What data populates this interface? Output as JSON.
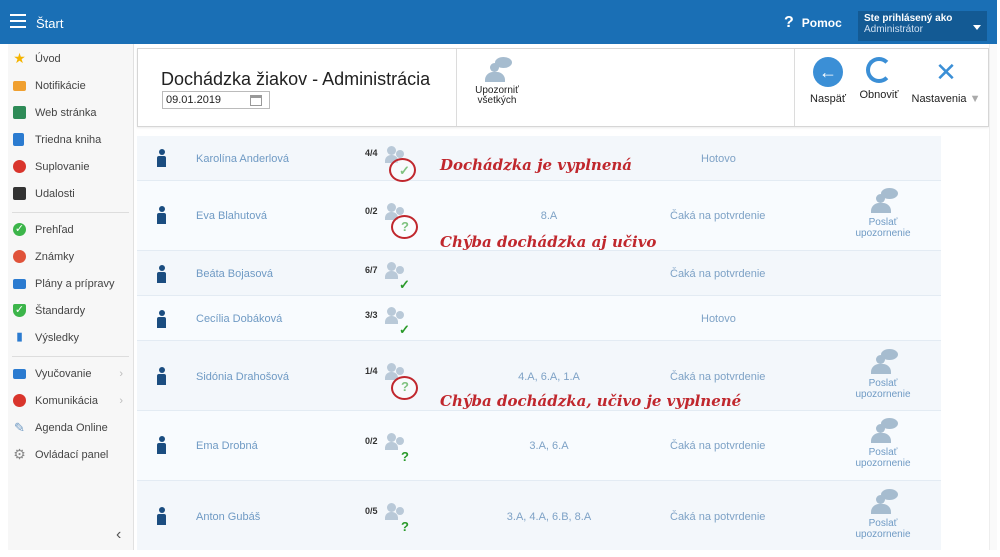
{
  "topbar": {
    "title": "Štart",
    "help_label": "Pomoc",
    "help_glyph": "?",
    "user_line1": "Ste prihlásený ako",
    "user_line2": "Administrátor"
  },
  "sidebar": {
    "items": [
      {
        "label": "Úvod",
        "icon": "star-icon",
        "color": "#f5b400"
      },
      {
        "label": "Notifikácie",
        "icon": "envelope-icon",
        "color": "#f0a030"
      },
      {
        "label": "Web stránka",
        "icon": "home-icon",
        "color": "#2e8b57"
      },
      {
        "label": "Triedna kniha",
        "icon": "book-icon",
        "color": "#2b7bd0"
      },
      {
        "label": "Suplovanie",
        "icon": "user-swap-icon",
        "color": "#d9352c"
      },
      {
        "label": "Udalosti",
        "icon": "calendar-icon",
        "color": "#333333"
      },
      {
        "label": "Prehľad",
        "icon": "check-circle-icon",
        "color": "#3cb54a"
      },
      {
        "label": "Známky",
        "icon": "grades-icon",
        "color": "#e0533a"
      },
      {
        "label": "Plány a prípravy",
        "icon": "briefcase-icon",
        "color": "#2b7bd0"
      },
      {
        "label": "Štandardy",
        "icon": "shield-icon",
        "color": "#3cb54a"
      },
      {
        "label": "Výsledky",
        "icon": "bar-chart-icon",
        "color": "#2b7bd0"
      },
      {
        "label": "Vyučovanie",
        "icon": "school-icon",
        "color": "#2b7bd0"
      },
      {
        "label": "Komunikácia",
        "icon": "chat-icon",
        "color": "#d9352c"
      },
      {
        "label": "Agenda Online",
        "icon": "pen-icon",
        "color": "#6f9ac4"
      },
      {
        "label": "Ovládací panel",
        "icon": "gear-icon",
        "color": "#888888"
      }
    ],
    "collapse_glyph": "‹"
  },
  "header": {
    "title": "Dochádzka žiakov - Administrácia",
    "date": "09.01.2019",
    "notify_all_line1": "Upozorniť",
    "notify_all_line2": "všetkých",
    "back_label": "Naspäť",
    "refresh_label": "Obnoviť",
    "settings_label": "Nastavenia"
  },
  "rows": [
    {
      "name": "Karolína Anderlová",
      "frac": "4/4",
      "mark": "✓",
      "classes": "",
      "status": "Hotovo",
      "send_line1": "",
      "send_line2": ""
    },
    {
      "name": "Eva Blahutová",
      "frac": "0/2",
      "mark": "?",
      "classes": "8.A",
      "status": "Čaká na potvrdenie",
      "send_line1": "Poslať",
      "send_line2": "upozornenie"
    },
    {
      "name": "Beáta Bojasová",
      "frac": "6/7",
      "mark": "✓",
      "classes": "",
      "status": "Čaká na potvrdenie",
      "send_line1": "",
      "send_line2": ""
    },
    {
      "name": "Cecília Dobáková",
      "frac": "3/3",
      "mark": "✓",
      "classes": "",
      "status": "Hotovo",
      "send_line1": "",
      "send_line2": ""
    },
    {
      "name": "Sidónia Drahošová",
      "frac": "1/4",
      "mark": "?",
      "classes": "4.A, 6.A, 1.A",
      "status": "Čaká na potvrdenie",
      "send_line1": "Poslať",
      "send_line2": "upozornenie"
    },
    {
      "name": "Ema Drobná",
      "frac": "0/2",
      "mark": "?",
      "classes": "3.A, 6.A",
      "status": "Čaká na potvrdenie",
      "send_line1": "Poslať",
      "send_line2": "upozornenie"
    },
    {
      "name": "Anton Gubáš",
      "frac": "0/5",
      "mark": "?",
      "classes": "3.A, 4.A, 6.B, 8.A",
      "status": "Čaká na potvrdenie",
      "send_line1": "Poslať",
      "send_line2": "upozornenie"
    }
  ],
  "annotations": {
    "a1": "Dochádzka je vyplnená",
    "a2": "Chýba dochádzka aj učivo",
    "a3": "Chýba dochádzka, učivo je vyplnené"
  },
  "colors": {
    "topbar": "#1a6fb5",
    "annotation": "#c0272d",
    "link": "#6f9ac4"
  }
}
